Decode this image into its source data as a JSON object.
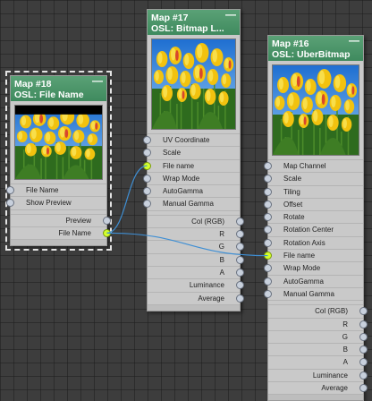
{
  "nodes": [
    {
      "id": "map18",
      "title1": "Map #18",
      "title2": "OSL: File Name",
      "minimize": "—",
      "selected": true,
      "inputs": [
        "File Name",
        "Show Preview"
      ],
      "outputs": [
        "Preview",
        "File Name"
      ]
    },
    {
      "id": "map17",
      "title1": "Map #17",
      "title2": "OSL: Bitmap L...",
      "minimize": "—",
      "selected": false,
      "inputs": [
        "UV Coordinate",
        "Scale",
        "File name",
        "Wrap Mode",
        "AutoGamma",
        "Manual Gamma"
      ],
      "outputs": [
        "Col (RGB)",
        "R",
        "G",
        "B",
        "A",
        "Luminance",
        "Average"
      ]
    },
    {
      "id": "map16",
      "title1": "Map #16",
      "title2": "OSL: UberBitmap",
      "minimize": "—",
      "selected": false,
      "inputs": [
        "Map Channel",
        "Scale",
        "Tiling",
        "Offset",
        "Rotate",
        "Rotation Center",
        "Rotation Axis",
        "File name",
        "Wrap Mode",
        "AutoGamma",
        "Manual Gamma"
      ],
      "outputs": [
        "Col (RGB)",
        "R",
        "G",
        "B",
        "A",
        "Luminance",
        "Average"
      ]
    }
  ],
  "connections": [
    {
      "from_node": "map18",
      "from_output": "File Name",
      "to_node": "map17",
      "to_input": "File name"
    },
    {
      "from_node": "map18",
      "from_output": "File Name",
      "to_node": "map16",
      "to_input": "File name"
    }
  ],
  "colors": {
    "header": "#4a9468",
    "wire": "#3f8fd4",
    "active_socket": "#d4ff2c",
    "socket": "#c8d0dc"
  }
}
